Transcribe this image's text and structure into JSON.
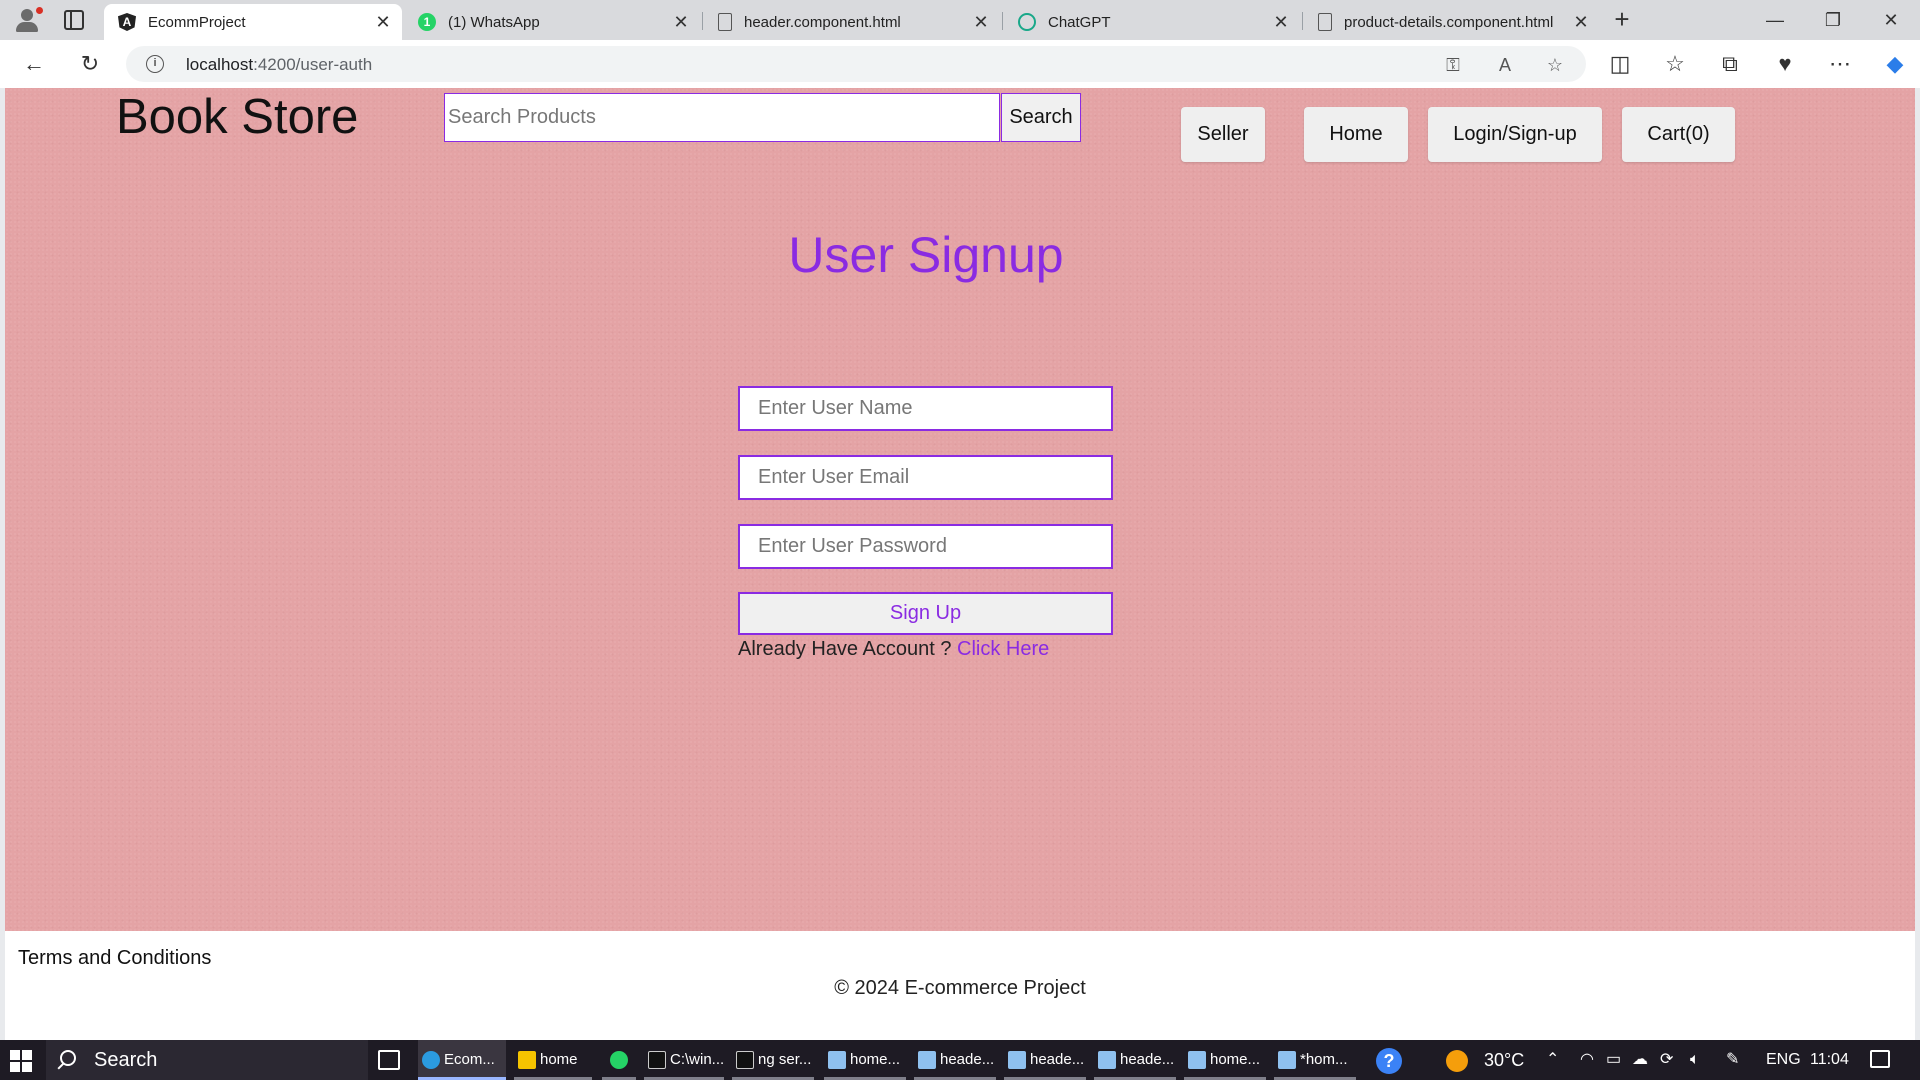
{
  "browser": {
    "tabs": [
      {
        "title": "EcommProject",
        "icon": "angular-icon",
        "active": true
      },
      {
        "title": "(1) WhatsApp",
        "icon": "whatsapp-icon",
        "active": false
      },
      {
        "title": "header.component.html",
        "icon": "file-icon",
        "active": false
      },
      {
        "title": "ChatGPT",
        "icon": "chatgpt-icon",
        "active": false
      },
      {
        "title": "product-details.component.html",
        "icon": "file-icon",
        "active": false
      }
    ],
    "url_host": "localhost",
    "url_path": ":4200/user-auth"
  },
  "header": {
    "brand": "Book Store",
    "search_placeholder": "Search Products",
    "search_button": "Search",
    "nav": [
      "Seller",
      "Home",
      "Login/Sign-up",
      "Cart(0)"
    ]
  },
  "signup": {
    "title": "User Signup",
    "name_placeholder": "Enter User Name",
    "email_placeholder": "Enter User Email",
    "password_placeholder": "Enter User Password",
    "submit": "Sign Up",
    "already_text": "Already Have Account ?",
    "login_link": "Click Here"
  },
  "footer": {
    "terms": "Terms and Conditions",
    "copyright": "© 2024 E-commerce Project"
  },
  "taskbar": {
    "search": "Search",
    "apps": [
      "Ecom...",
      "home",
      "C:\\win...",
      "ng ser...",
      "home...",
      "heade...",
      "heade...",
      "heade...",
      "home...",
      "*hom..."
    ],
    "temperature": "30°C",
    "language": "ENG",
    "time": "11:04"
  }
}
